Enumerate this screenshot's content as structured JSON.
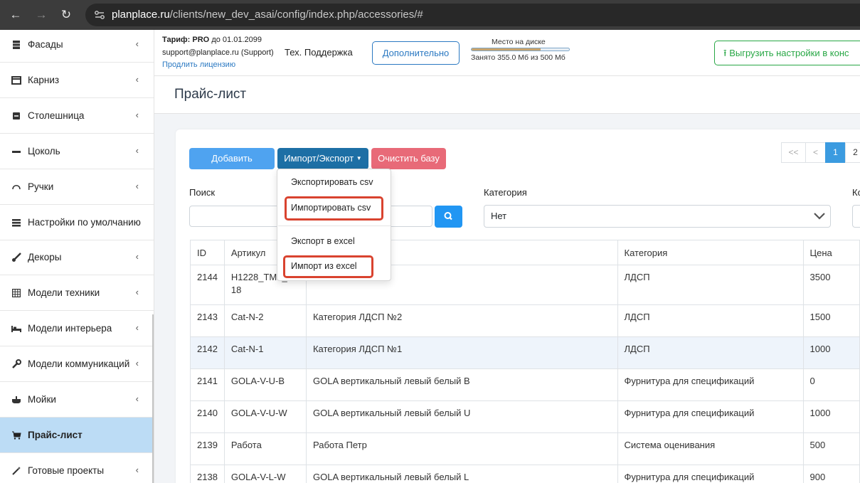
{
  "browser": {
    "url_host": "planplace.ru",
    "url_path": "/clients/new_dev_asai/config/index.php/accessories/#"
  },
  "sidebar": {
    "items": [
      {
        "label": "Фасады",
        "icon": "facade-icon",
        "chevron": true
      },
      {
        "label": "Карниз",
        "icon": "window-icon",
        "chevron": true
      },
      {
        "label": "Столешница",
        "icon": "countertop-icon",
        "chevron": true
      },
      {
        "label": "Цоколь",
        "icon": "plinth-icon",
        "chevron": true
      },
      {
        "label": "Ручки",
        "icon": "handle-icon",
        "chevron": true
      },
      {
        "label": "Настройки по умолчанию",
        "icon": "settings-list-icon",
        "chevron": false
      },
      {
        "label": "Декоры",
        "icon": "brush-icon",
        "chevron": true
      },
      {
        "label": "Модели техники",
        "icon": "grid-icon",
        "chevron": true
      },
      {
        "label": "Модели интерьера",
        "icon": "bed-icon",
        "chevron": true
      },
      {
        "label": "Модели коммуникаций",
        "icon": "wrench-icon",
        "chevron": true
      },
      {
        "label": "Мойки",
        "icon": "sink-icon",
        "chevron": true
      },
      {
        "label": "Прайс-лист",
        "icon": "cart-icon",
        "chevron": false,
        "active": true
      },
      {
        "label": "Готовые проекты",
        "icon": "magic-wand-icon",
        "chevron": true
      }
    ]
  },
  "topbar": {
    "tarif_label": "Тариф:",
    "tarif_value": "PRO",
    "tarif_until": "до 01.01.2099",
    "support_email": "support@planplace.ru (Support)",
    "license_link": "Продлить лицензию",
    "tech_support": "Тех. Поддержка",
    "extra_button": "Дополнительно",
    "disk_label": "Место на диске",
    "disk_usage": "Занято 355.0 Мб из 500 Мб",
    "disk_fraction": 0.71,
    "upload_button": "Выгрузить настройки в конс"
  },
  "page": {
    "title": "Прайс-лист"
  },
  "toolbar": {
    "add_button": "Добавить",
    "import_export_button": "Импорт/Экспорт",
    "clear_button": "Очистить базу"
  },
  "pagination": {
    "first": "<<",
    "prev": "<",
    "pages": [
      "1",
      "2"
    ],
    "current": "1"
  },
  "filters": {
    "search_label": "Поиск",
    "category_label": "Категория",
    "category_value": "Нет",
    "third_label_partial": "Ко"
  },
  "dropdown": {
    "items": [
      "Экспортировать csv",
      "Импортировать csv",
      "Экспорт в excel",
      "Импорт из excel"
    ],
    "highlight_color": "#d9432f"
  },
  "table": {
    "headers": [
      "ID",
      "Артикул",
      "",
      "Категория",
      "Цена"
    ],
    "rows": [
      {
        "id": "2144",
        "article": "H1228_TM1_1_18",
        "name": "",
        "category": "ЛДСП",
        "price": "3500"
      },
      {
        "id": "2143",
        "article": "Cat-N-2",
        "name": "Категория ЛДСП №2",
        "category": "ЛДСП",
        "price": "1500"
      },
      {
        "id": "2142",
        "article": "Cat-N-1",
        "name": "Категория ЛДСП №1",
        "category": "ЛДСП",
        "price": "1000"
      },
      {
        "id": "2141",
        "article": "GOLA-V-U-B",
        "name": "GOLA вертикальный левый белый B",
        "category": "Фурнитура для спецификаций",
        "price": "0"
      },
      {
        "id": "2140",
        "article": "GOLA-V-U-W",
        "name": "GOLA вертикальный левый белый U",
        "category": "Фурнитура для спецификаций",
        "price": "1000"
      },
      {
        "id": "2139",
        "article": "Работа",
        "name": "Работа Петр",
        "category": "Система оценивания",
        "price": "500"
      },
      {
        "id": "2138",
        "article": "GOLA-V-L-W",
        "name": "GOLA вертикальный левый белый L",
        "category": "Фурнитура для спецификаций",
        "price": "900"
      }
    ]
  }
}
